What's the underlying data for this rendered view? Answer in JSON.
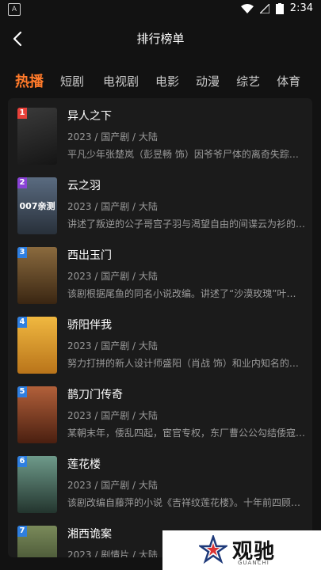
{
  "statusbar": {
    "time": "2:34",
    "left_badge": "A"
  },
  "header": {
    "title": "排行榜单"
  },
  "tabs": [
    "热播",
    "短剧",
    "电视剧",
    "电影",
    "动漫",
    "综艺",
    "体育"
  ],
  "items": [
    {
      "rank": "1",
      "name": "异人之下",
      "meta": "2023 / 国产剧 / 大陆",
      "desc": "平凡少年张楚岚（彭昱畅 饰）因爷爷尸体的离奇失踪…"
    },
    {
      "rank": "2",
      "name": "云之羽",
      "meta": "2023 / 国产剧 / 大陆",
      "desc": "讲述了叛逆的公子哥宫子羽与渴望自由的间谍云为衫的…"
    },
    {
      "rank": "3",
      "name": "西出玉门",
      "meta": "2023 / 国产剧 / 大陆",
      "desc": "该剧根据尾鱼的同名小说改编。讲述了“沙漠玫瑰”叶流…"
    },
    {
      "rank": "4",
      "name": "骄阳伴我",
      "meta": "2023 / 国产剧 / 大陆",
      "desc": "努力打拼的新人设计师盛阳（肖战 饰）和业内知名的…"
    },
    {
      "rank": "5",
      "name": "鹊刀门传奇",
      "meta": "2023 / 国产剧 / 大陆",
      "desc": "某朝末年，倭乱四起，宦官专权，东厂曹公公勾结倭寇…"
    },
    {
      "rank": "6",
      "name": "莲花楼",
      "meta": "2023 / 国产剧 / 大陆",
      "desc": "该剧改编自藤萍的小说《吉祥纹莲花楼》。十年前四顾…"
    },
    {
      "rank": "7",
      "name": "湘西诡案",
      "meta": "2023 / 剧情片 / 大陆",
      "desc": ""
    }
  ],
  "poster_texts": [
    "",
    "007亲测",
    "",
    "",
    "",
    "",
    ""
  ],
  "rank_colors": [
    "#e8413a",
    "#8a43d6",
    "#2f7fe0",
    "#2f7fe0",
    "#2f7fe0",
    "#2f7fe0",
    "#2f7fe0"
  ],
  "poster_colors": [
    "#2b2b2b",
    "#3a4a5c",
    "#6b4a2a",
    "#d99a2a",
    "#7a3a22",
    "#3a5a4a",
    "#5a6a4a"
  ],
  "watermark": {
    "text": "观驰",
    "sub": "GUANCHI"
  }
}
